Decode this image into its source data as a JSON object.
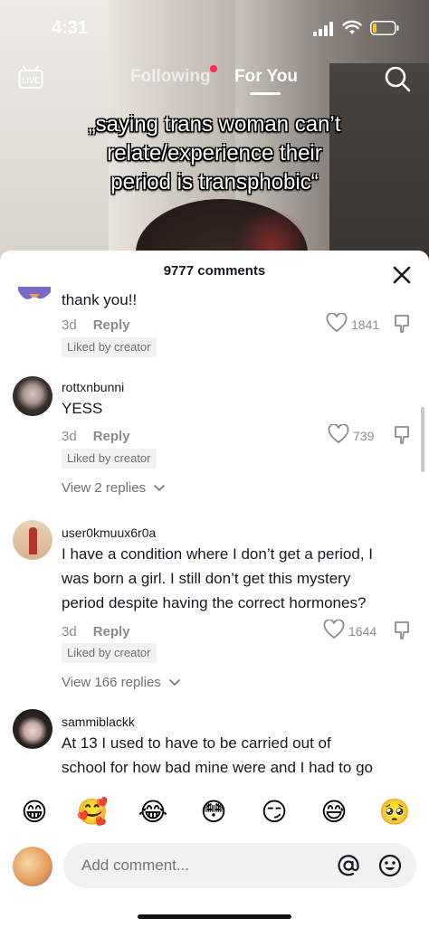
{
  "status": {
    "time": "4:31"
  },
  "nav": {
    "live_label": "LIVE",
    "tab_following": "Following",
    "tab_for_you": "For You"
  },
  "video": {
    "caption_line1": "„saying trans woman can’t",
    "caption_line2": "relate/experience their",
    "caption_line3": "period is transphobic“"
  },
  "comments_panel": {
    "title": "9777 comments",
    "comments": [
      {
        "text": "thank you!!",
        "age": "3d",
        "reply_label": "Reply",
        "likes": "1841",
        "badge": "Liked by creator"
      },
      {
        "username": "rottxnbunni",
        "text": "YESS",
        "age": "3d",
        "reply_label": "Reply",
        "likes": "739",
        "badge": "Liked by creator",
        "view_replies": "View 2 replies"
      },
      {
        "username": "user0kmuux6r0a",
        "text_line1": "I have a condition where I don’t get a period, I",
        "text_line2": "was born a girl. I still don’t get this mystery",
        "text_line3": "period despite having the correct hormones?",
        "age": "3d",
        "reply_label": "Reply",
        "likes": "1644",
        "badge": "Liked by creator",
        "view_replies": "View 166 replies"
      },
      {
        "username": "sammiblackk",
        "text_line1": "At 13 I used to have to be carried out of",
        "text_line2": "school for how bad mine were and I had to go"
      }
    ]
  },
  "emoji_bar": [
    "😁",
    "🥰",
    "😂",
    "😳",
    "😏",
    "😅",
    "🥺"
  ],
  "composer": {
    "placeholder": "Add comment..."
  },
  "colors": {
    "accent": "#fe2c55",
    "text": "#161823",
    "muted": "#8a8b91"
  }
}
